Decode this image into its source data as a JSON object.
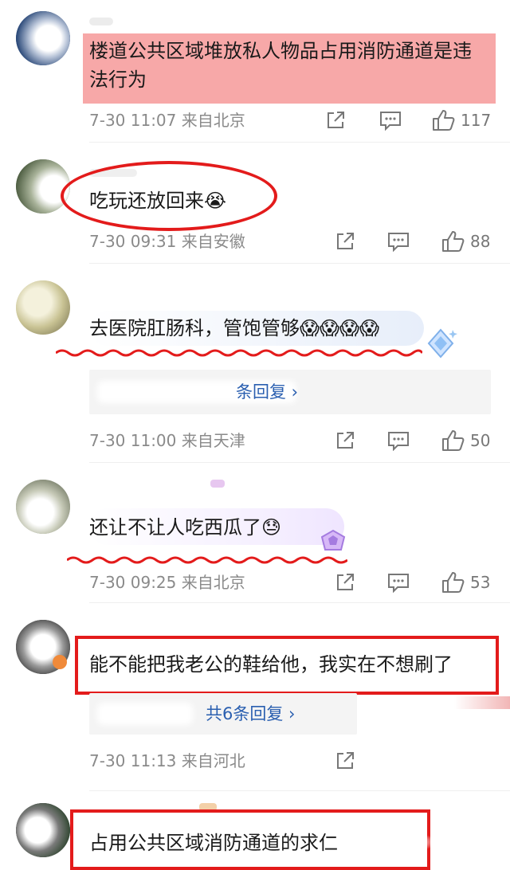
{
  "comments": [
    {
      "text": "楼道公共区域堆放私人物品占用消防通道是违法行为",
      "time": "7-30 11:07 来自北京",
      "likes": "117"
    },
    {
      "text": "吃玩还放回来😭",
      "time": "7-30 09:31 来自安徽",
      "likes": "88"
    },
    {
      "text": "去医院肛肠科，管饱管够😱😱😱😱",
      "reply_link": "条回复 ›",
      "time": "7-30 11:00 来自天津",
      "likes": "50"
    },
    {
      "text": "还让不让人吃西瓜了😓",
      "time": "7-30 09:25 来自北京",
      "likes": "53"
    },
    {
      "text": "能不能把我老公的鞋给他，我实在不想刷了",
      "reply_link": "共6条回复 ›",
      "time": "7-30 11:13 来自河北"
    },
    {
      "text": "占用公共区域消防通道的求仁"
    }
  ],
  "icons": [
    "share-icon",
    "comment-icon",
    "like-icon"
  ],
  "colors": {
    "annotation_red": "#e31b1b",
    "highlight": "#f7a8a8",
    "link_blue": "#2a5fb0",
    "meta_gray": "#8a8a8a"
  }
}
